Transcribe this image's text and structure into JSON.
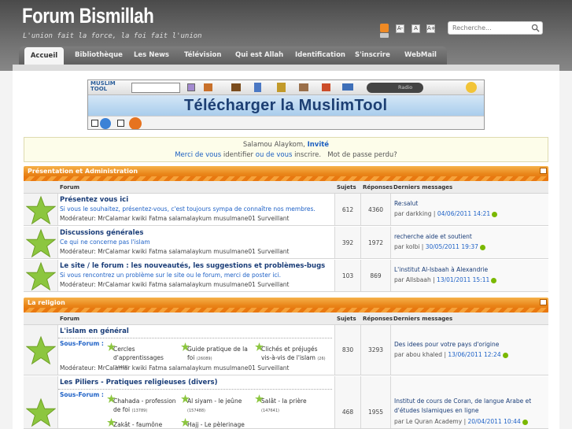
{
  "header": {
    "site_title": "Forum Bismillah",
    "slogan": "L'union fait la force, la foi fait l'union",
    "search_placeholder": "Recherche...",
    "font_labels": [
      "A-",
      "A",
      "A+"
    ]
  },
  "nav": {
    "items": [
      "Accueil",
      "Bibliothèque",
      "Les News",
      "Télévision",
      "Qui est Allah",
      "Identification",
      "S'inscrire",
      "WebMail"
    ]
  },
  "banner": {
    "brand": "MUSLIM TOOL",
    "title": "Télécharger la MuslimTool",
    "radio": "Radio"
  },
  "welcome": {
    "greeting": "Salamou Alaykom,",
    "user": "Invité",
    "line2_a": "Merci de vous",
    "line2_b": "identifier",
    "line2_c": "ou de vous",
    "line2_d": "inscrire.",
    "line2_e": "Mot de passe perdu?"
  },
  "table_headers": {
    "forum": "Forum",
    "topics": "Sujets",
    "replies": "Réponses",
    "last": "Derniers messages"
  },
  "categories": [
    {
      "title": "Présentation et Administration",
      "forums": [
        {
          "title": "Présentez vous ici",
          "desc": "Si vous le souhaitez, présentez-vous, c'est toujours sympa de connaître nos membres.",
          "mods": "Modérateur: MrCalamar  kwiki  Fatma  salamalaykum  musulmane01  Surveillant",
          "topics": "612",
          "replies": "4360",
          "last_title": "Re:salut",
          "last_by": "par darkking |",
          "last_date": "04/06/2011 14:21"
        },
        {
          "title": "Discussions générales",
          "desc": "Ce qui ne concerne pas l'islam",
          "mods": "Modérateur: MrCalamar  kwiki  Fatma  salamalaykum  musulmane01  Surveillant",
          "topics": "392",
          "replies": "1972",
          "last_title": "recherche aide et soutient",
          "last_by": "par kolbi |",
          "last_date": "30/05/2011 19:37"
        },
        {
          "title": "Le site / le forum : les nouveautés, les suggestions et problèmes-bugs",
          "desc": "Si vous rencontrez un problème sur le site ou le forum, merci de poster ici.",
          "mods": "Modérateur: MrCalamar  kwiki  Fatma  salamalaykum  musulmane01  Surveillant",
          "topics": "103",
          "replies": "869",
          "last_title": "L'institut Al-Isbaah à Alexandrie",
          "last_by": "par Allsbaah |",
          "last_date": "13/01/2011 15:11"
        }
      ]
    },
    {
      "title": "La religion",
      "forums": [
        {
          "title": "L'islam en général",
          "subforum_label": "Sous-Forum :",
          "subforums": [
            {
              "name": "Cercles d'apprentissages",
              "count": "(14438)"
            },
            {
              "name": "Guide pratique de la foi",
              "count": "(26089)"
            },
            {
              "name": "Clichés et préjugés vis-à-vis de l'islam",
              "count": "(26)"
            }
          ],
          "mods": "Modérateur: MrCalamar  kwiki  Fatma  salamalaykum  musulmane01  Surveillant",
          "topics": "830",
          "replies": "3293",
          "last_title": "Des idees pour votre pays d'origine",
          "last_by": "par abou khaled |",
          "last_date": "13/06/2011 12:24"
        },
        {
          "title": "Les Piliers - Pratiques religieuses (divers)",
          "subforum_label": "Sous-Forum :",
          "subforums": [
            {
              "name": "Chahada - profession de foi",
              "count": "(13789)"
            },
            {
              "name": "Al siyam - le jeûne",
              "count": "(157488)"
            },
            {
              "name": "Salât - la prière",
              "count": "(147641)"
            },
            {
              "name": "Zakât - faumône",
              "count": ""
            },
            {
              "name": "Hajj - Le pèlerinage",
              "count": ""
            }
          ],
          "topics": "468",
          "replies": "1955",
          "last_title": "Institut de cours de Coran, de langue Arabe et d'études Islamiques en ligne",
          "last_by": "par Le Quran Academy |",
          "last_date": "20/04/2011 10:44"
        }
      ]
    }
  ],
  "colors": {
    "accent_orange": "#e98418",
    "link_blue": "#1f62c7",
    "title_navy": "#1a3d78",
    "star_green": "#8cc63f"
  }
}
